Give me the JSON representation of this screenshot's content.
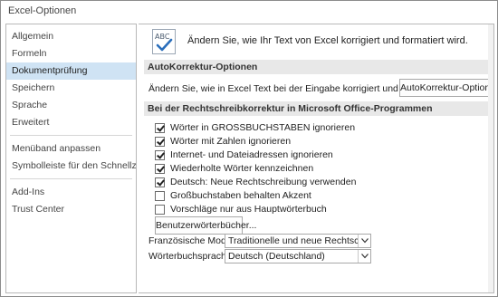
{
  "window": {
    "title": "Excel-Optionen"
  },
  "sidebar": {
    "items": [
      {
        "label": "Allgemein",
        "selected": false
      },
      {
        "label": "Formeln",
        "selected": false
      },
      {
        "label": "Dokumentprüfung",
        "selected": true
      },
      {
        "label": "Speichern",
        "selected": false
      },
      {
        "label": "Sprache",
        "selected": false
      },
      {
        "label": "Erweitert",
        "selected": false
      },
      {
        "label": "Menüband anpassen",
        "selected": false
      },
      {
        "label": "Symbolleiste für den Schnellzugriff",
        "selected": false
      },
      {
        "label": "Add-Ins",
        "selected": false
      },
      {
        "label": "Trust Center",
        "selected": false
      }
    ]
  },
  "main": {
    "hero": {
      "icon": "abc-check-icon",
      "text": "Ändern Sie, wie Ihr Text von Excel korrigiert und formatiert wird."
    },
    "autocorrect": {
      "header": "AutoKorrektur-Optionen",
      "description": "Ändern Sie, wie in Excel Text bei der Eingabe korrigiert und formatiert wird.",
      "button_label": "AutoKorrektur-Optionen..."
    },
    "spelling": {
      "header": "Bei der Rechtschreibkorrektur in Microsoft Office-Programmen",
      "options": [
        {
          "label": "Wörter in GROSSBUCHSTABEN ignorieren",
          "checked": true
        },
        {
          "label": "Wörter mit Zahlen ignorieren",
          "checked": true
        },
        {
          "label": "Internet- und Dateiadressen ignorieren",
          "checked": true
        },
        {
          "label": "Wiederholte Wörter kennzeichnen",
          "checked": true
        },
        {
          "label": "Deutsch: Neue Rechtschreibung verwenden",
          "checked": true
        },
        {
          "label": "Großbuchstaben behalten Akzent",
          "checked": false
        },
        {
          "label": "Vorschläge nur aus Hauptwörterbuch",
          "checked": false
        }
      ],
      "dictionaries_button": "Benutzerwörterbücher...",
      "french_modes": {
        "label": "Französische Modi:",
        "value": "Traditionelle und neue Rechtschreibung"
      },
      "dictionary_language": {
        "label": "Wörterbuchsprache:",
        "value": "Deutsch (Deutschland)"
      }
    }
  },
  "colors": {
    "selected_bg": "#cfe3f4",
    "section_header_bg": "#e8e8e8",
    "border": "#b8b8b8",
    "accent_blue": "#2a6ebb"
  }
}
